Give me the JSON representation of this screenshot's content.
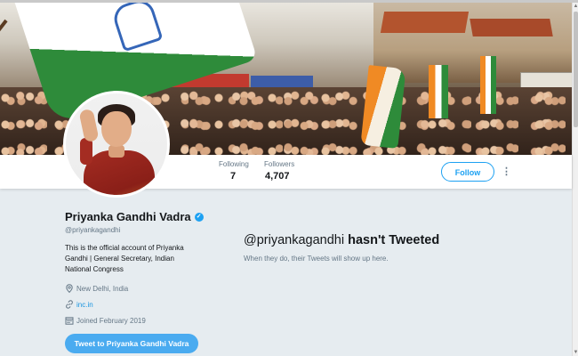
{
  "profile": {
    "name": "Priyanka Gandhi Vadra",
    "handle": "@priyankagandhi",
    "verified": true,
    "bio": "This is the official account of Priyanka Gandhi | General Secretary, Indian National Congress",
    "location": "New Delhi, India",
    "website": "inc.in",
    "joined": "Joined February 2019",
    "tweet_to_label": "Tweet to Priyanka Gandhi Vadra"
  },
  "stats": {
    "following_label": "Following",
    "following_value": "7",
    "followers_label": "Followers",
    "followers_value": "4,707"
  },
  "nav": {
    "follow_label": "Follow",
    "more_glyph": "⋮"
  },
  "timeline": {
    "empty_handle": "@priyankagandhi",
    "empty_rest": " hasn't Tweeted",
    "empty_subtitle": "When they do, their Tweets will show up here."
  },
  "icons": {
    "verified": "verified-badge-icon",
    "location": "map-pin-icon",
    "website": "link-icon",
    "joined": "calendar-icon",
    "more": "more-vertical-icon"
  },
  "colors": {
    "brand_blue": "#1da1f2",
    "tweet_button": "#4aabf0",
    "page_bg": "#e6ecf0",
    "muted_text": "#657786"
  }
}
